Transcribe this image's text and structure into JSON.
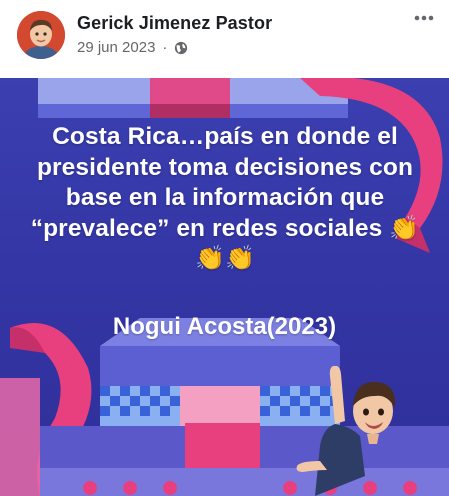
{
  "post": {
    "author": "Gerick Jimenez Pastor",
    "date": "29 jun 2023",
    "separator": "·",
    "privacy_icon": "globe-icon",
    "more_icon": "more-options-icon"
  },
  "image": {
    "caption": "Costa Rica…país en donde el presidente toma decisiones con base en la información que “prevalece” en redes sociales",
    "emojis": "👏👏👏",
    "credit": "Nogui Acosta(2023)"
  },
  "colors": {
    "background_blue": "#3436a5",
    "accent_pink": "#e8407e",
    "emoji_yellow": "#ffc83d"
  }
}
